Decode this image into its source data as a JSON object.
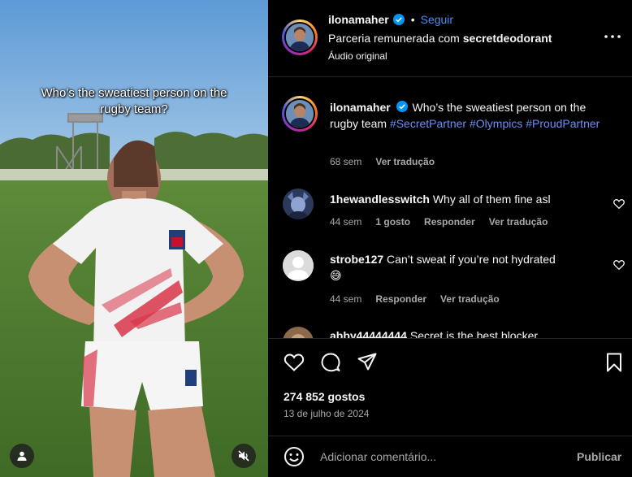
{
  "video": {
    "overlay_text": "Who’s the sweatiest person on the rugby team?",
    "user_button_icon": "user-icon",
    "mute_button_icon": "speaker-muted-icon"
  },
  "post_header": {
    "username": "ilonamaher",
    "verified": true,
    "dot": "•",
    "follow_label": "Seguir",
    "partnership_prefix": "Parceria remunerada com",
    "partner": "secretdeodorant",
    "audio": "Áudio original",
    "more_icon": "more-options-icon"
  },
  "caption": {
    "username": "ilonamaher",
    "text": "Who’s the sweatiest person on the rugby team",
    "hashtags": [
      "#SecretPartner",
      "#Olympics",
      "#ProudPartner"
    ],
    "time": "68 sem",
    "translate": "Ver tradução"
  },
  "comments": [
    {
      "username": "1hewandlesswitch",
      "text": "Why all of them fine asl",
      "time": "44 sem",
      "likes": "1 gosto",
      "reply": "Responder",
      "translate": "Ver tradução"
    },
    {
      "username": "strobe127",
      "text": "Can’t sweat if you’re not hydrated",
      "emoji": "😅",
      "time": "44 sem",
      "reply": "Responder",
      "translate": "Ver tradução"
    },
    {
      "username": "abby44444444",
      "text": "Secret is the best blocker"
    }
  ],
  "actions": {
    "like_icon": "heart-icon",
    "comment_icon": "comment-icon",
    "share_icon": "send-icon",
    "save_icon": "bookmark-icon",
    "likes_count": "274 852 gostos",
    "date": "13 de julho de 2024"
  },
  "comment_box": {
    "emoji_icon": "emoji-icon",
    "placeholder": "Adicionar comentário...",
    "publish_label": "Publicar"
  },
  "colors": {
    "background": "#000000",
    "link_blue": "#4a8df8",
    "hashtag": "#6d8ff5",
    "muted_text": "#a8a8a8",
    "divider": "#262626"
  }
}
